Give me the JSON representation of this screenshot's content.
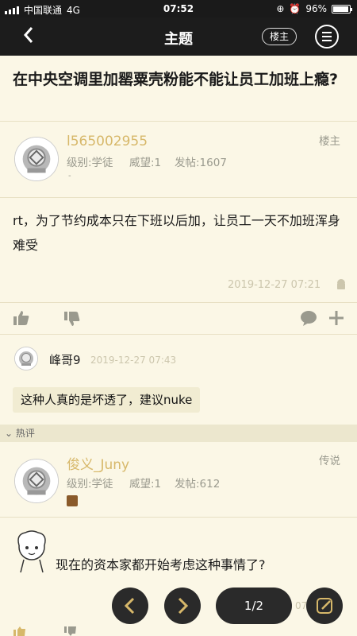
{
  "status_bar": {
    "carrier": "中国联通",
    "network": "4G",
    "time": "07:52",
    "battery": "96%",
    "battery_level": 0.96
  },
  "nav": {
    "back_icon": "chevron-left-icon",
    "title": "主题",
    "op_button": "楼主",
    "menu_icon": "menu-icon"
  },
  "topic": {
    "title": "在中央空调里加罂粟壳粉能不能让员工加班上瘾?"
  },
  "op_post": {
    "username": "l565002955",
    "role_tag": "楼主",
    "level": "级别:学徒",
    "prestige": "威望:1",
    "posts": "发帖:1607",
    "dash": "-",
    "content": "rt，为了节约成本只在下班以后加，让员工一天不加班浑身难受",
    "timestamp": "2019-12-27 07:21"
  },
  "reply_quick": {
    "username": "峰哥9",
    "timestamp": "2019-12-27 07:43",
    "content": "这种人真的是坏透了，建议nuke"
  },
  "hot_label": "热评",
  "reply2": {
    "username": "俊义_Juny",
    "role_tag": "传说",
    "level": "级别:学徒",
    "prestige": "威望:1",
    "posts": "发帖:612",
    "content": "现在的资本家都开始考虑这种事情了?"
  },
  "bottom": {
    "page": "1/2",
    "timestamp_partial": "07"
  },
  "colors": {
    "accent": "#d7b86a",
    "background": "#fbf7e6",
    "bar": "#1c1c1c"
  }
}
